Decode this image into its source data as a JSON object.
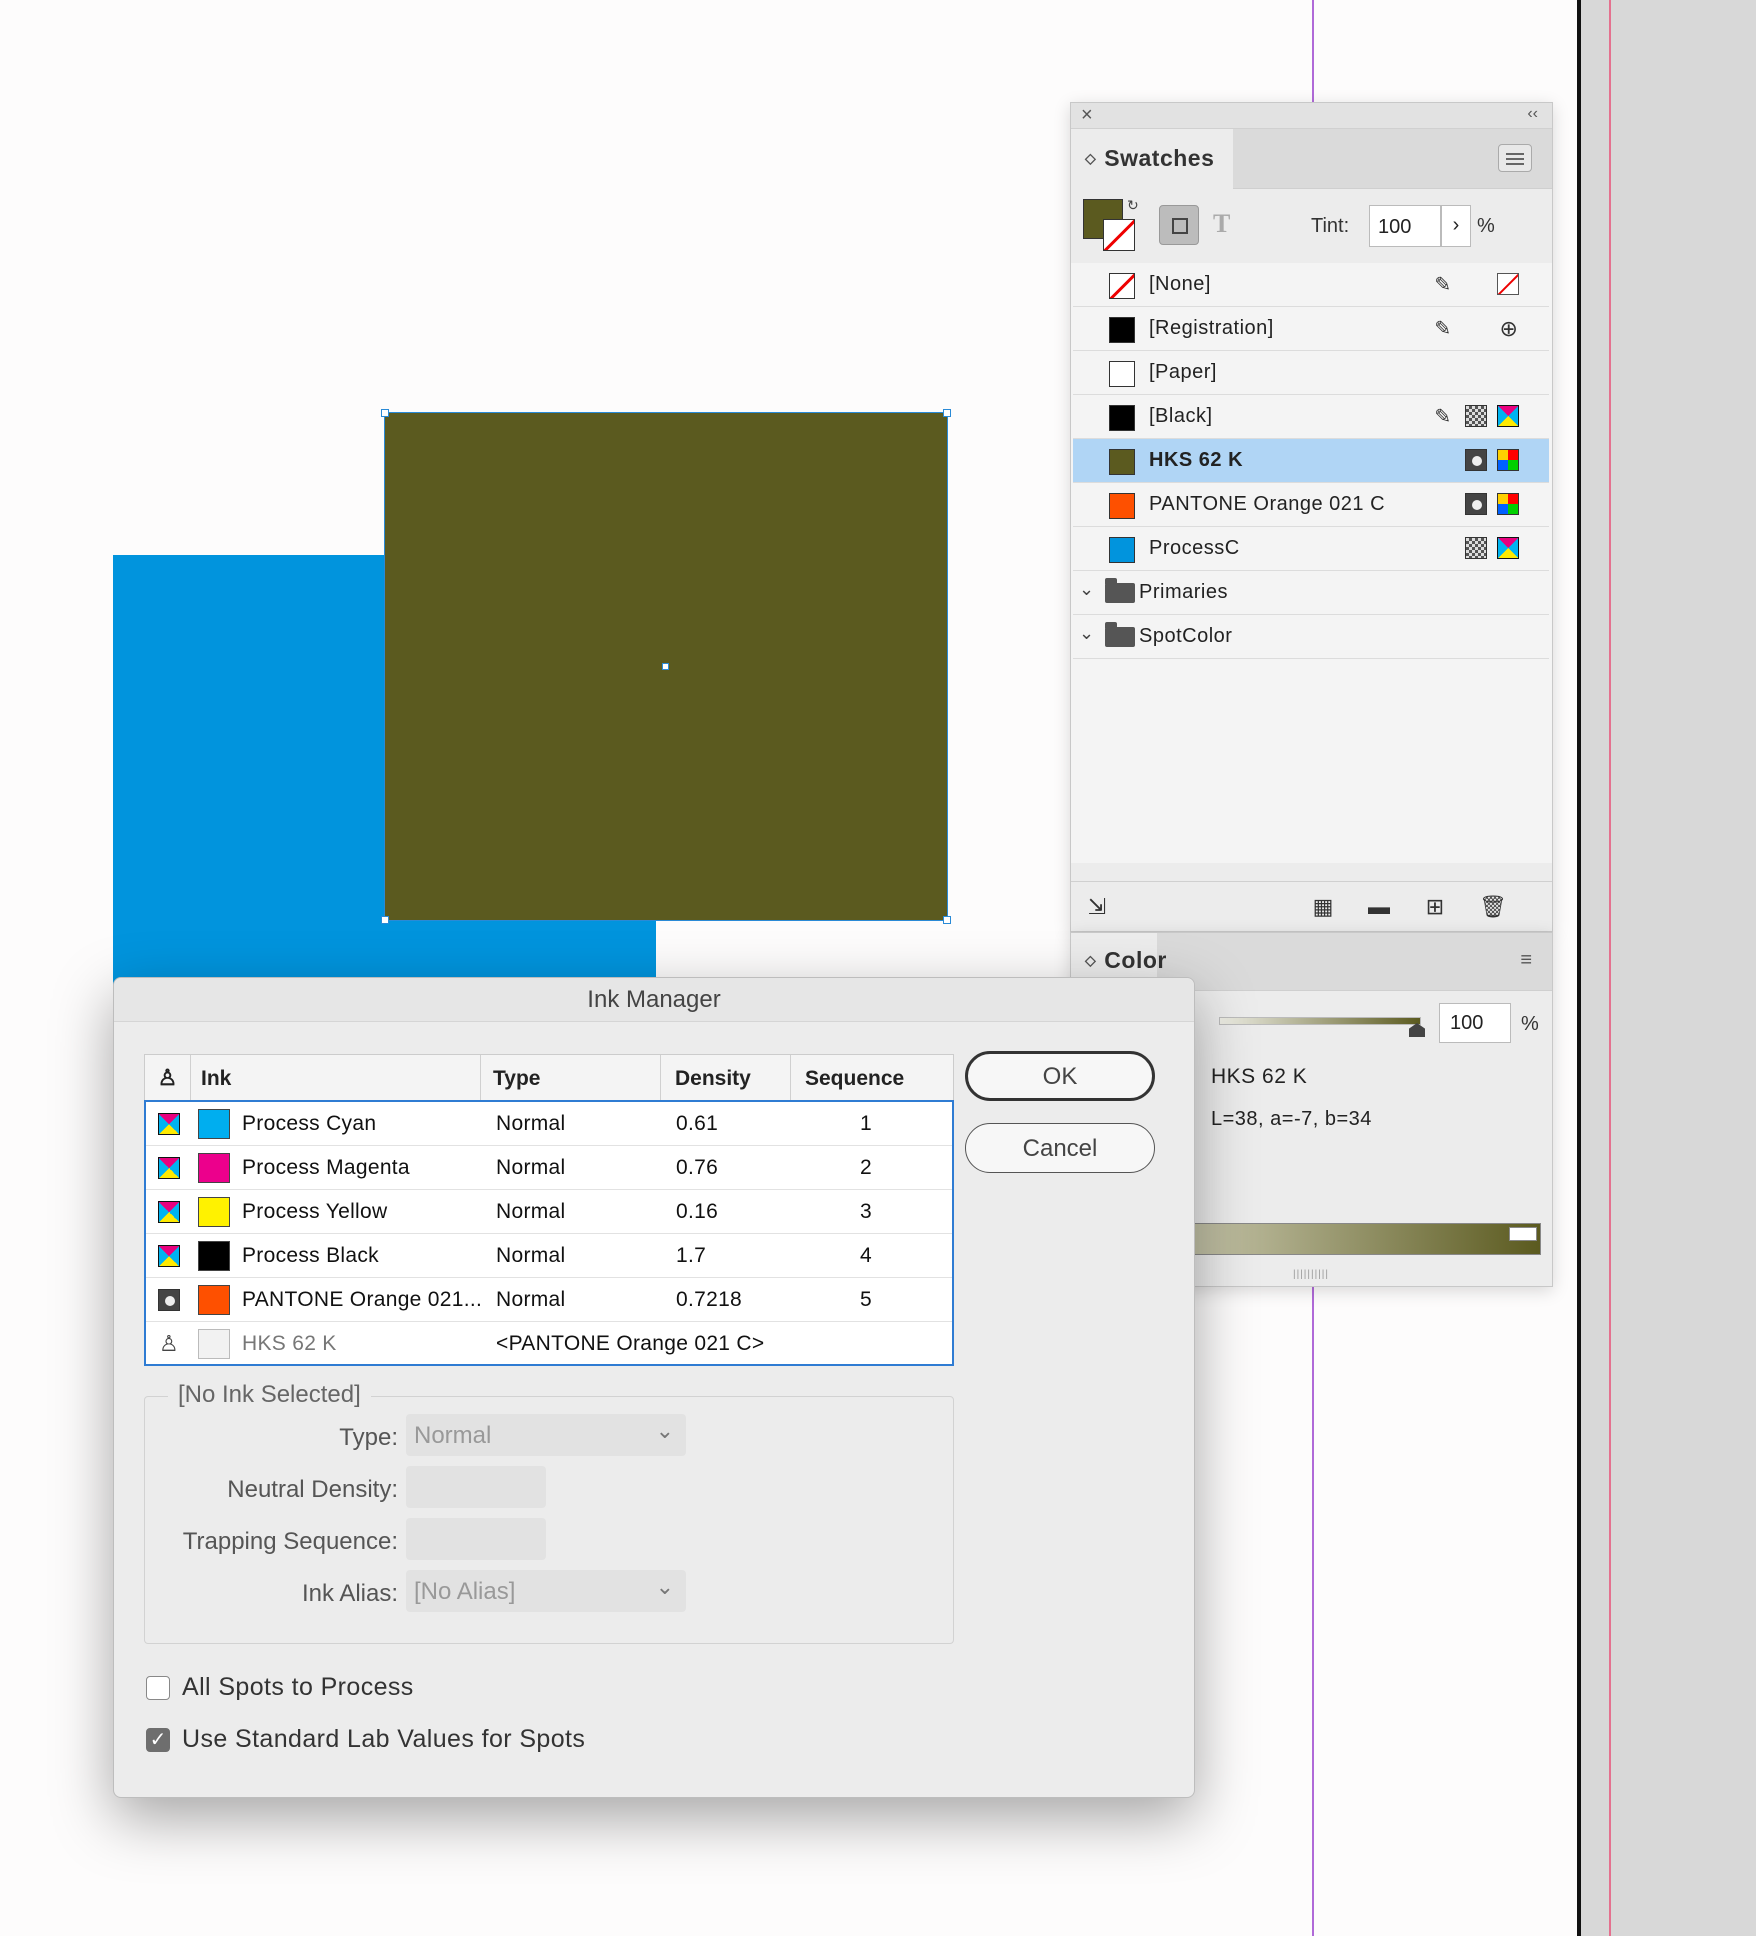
{
  "swatches": {
    "tab_label": "Swatches",
    "tint_label": "Tint:",
    "tint_value": "100",
    "tint_unit": "%",
    "fill_color": "#5b5a1f",
    "items": [
      {
        "name": "[None]",
        "color": "none"
      },
      {
        "name": "[Registration]",
        "color": "#000000"
      },
      {
        "name": "[Paper]",
        "color": "#ffffff"
      },
      {
        "name": "[Black]",
        "color": "#000000"
      },
      {
        "name": "HKS 62 K",
        "color": "#5b5a1f",
        "selected": true
      },
      {
        "name": "PANTONE Orange 021 C",
        "color": "#fe5000"
      },
      {
        "name": "ProcessC",
        "color": "#0194dd"
      }
    ],
    "groups": [
      {
        "name": "Primaries"
      },
      {
        "name": "SpotColor"
      }
    ]
  },
  "color_panel": {
    "tab_label": "Color",
    "tint_value": "100",
    "tint_unit": "%",
    "swatch_name": "HKS 62 K",
    "lab_values": "L=38, a=-7, b=34"
  },
  "ink_manager": {
    "title": "Ink Manager",
    "columns": [
      "Ink",
      "Type",
      "Density",
      "Sequence"
    ],
    "inks": [
      {
        "name": "Process Cyan",
        "type": "Normal",
        "density": "0.61",
        "sequence": "1",
        "color": "#00aeef"
      },
      {
        "name": "Process Magenta",
        "type": "Normal",
        "density": "0.76",
        "sequence": "2",
        "color": "#ec008c"
      },
      {
        "name": "Process Yellow",
        "type": "Normal",
        "density": "0.16",
        "sequence": "3",
        "color": "#fff200"
      },
      {
        "name": "Process Black",
        "type": "Normal",
        "density": "1.7",
        "sequence": "4",
        "color": "#000000"
      },
      {
        "name": "PANTONE Orange 021...",
        "type": "Normal",
        "density": "0.7218",
        "sequence": "5",
        "color": "#fe5000"
      },
      {
        "name": "HKS 62 K",
        "type": "<PANTONE Orange 021 C>",
        "density": "",
        "sequence": "",
        "color": "#f2f2f2"
      }
    ],
    "ok_label": "OK",
    "cancel_label": "Cancel",
    "detail_title": "[No Ink Selected]",
    "type_label": "Type:",
    "type_value": "Normal",
    "neutral_density_label": "Neutral Density:",
    "trapping_sequence_label": "Trapping Sequence:",
    "ink_alias_label": "Ink Alias:",
    "ink_alias_value": "[No Alias]",
    "all_spots_label": "All Spots to Process",
    "all_spots_checked": false,
    "use_lab_label": "Use Standard Lab Values for Spots",
    "use_lab_checked": true
  }
}
